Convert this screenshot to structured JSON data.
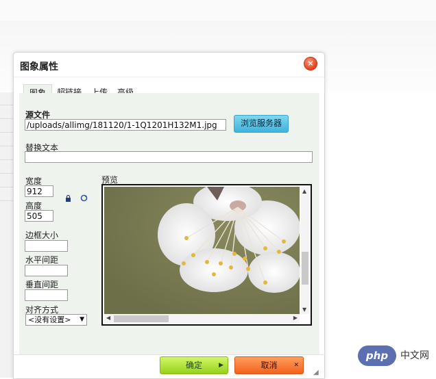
{
  "dialog": {
    "title": "图象属性",
    "close_glyph": "×"
  },
  "tabs": [
    {
      "label": "图象",
      "active": true
    },
    {
      "label": "超链接",
      "active": false
    },
    {
      "label": "上传",
      "active": false
    },
    {
      "label": "高级",
      "active": false
    }
  ],
  "image_tab": {
    "source_label": "源文件",
    "source_value": "/uploads/allimg/181120/1-1Q1201H132M1.jpg",
    "browse_label": "浏览服务器",
    "alt_label": "替换文本",
    "alt_value": "",
    "width_label": "宽度",
    "width_value": "912",
    "height_label": "高度",
    "height_value": "505",
    "border_label": "边框大小",
    "border_value": "",
    "hspace_label": "水平间距",
    "hspace_value": "",
    "vspace_label": "垂直间距",
    "vspace_value": "",
    "align_label": "对齐方式",
    "align_value": "<没有设置>",
    "preview_label": "预览"
  },
  "footer": {
    "ok_label": "确定",
    "cancel_label": "取消"
  },
  "watermark": {
    "badge": "php",
    "text": "中文网"
  },
  "colors": {
    "ok_button": "#a6dc2a",
    "cancel_button": "#f2621c",
    "close_button": "#e2401f",
    "browse_button": "#3fb3dc",
    "panel_bg": "#eef3ee"
  },
  "icons": {
    "lock": "lock-icon",
    "reset": "reset-size-icon"
  }
}
